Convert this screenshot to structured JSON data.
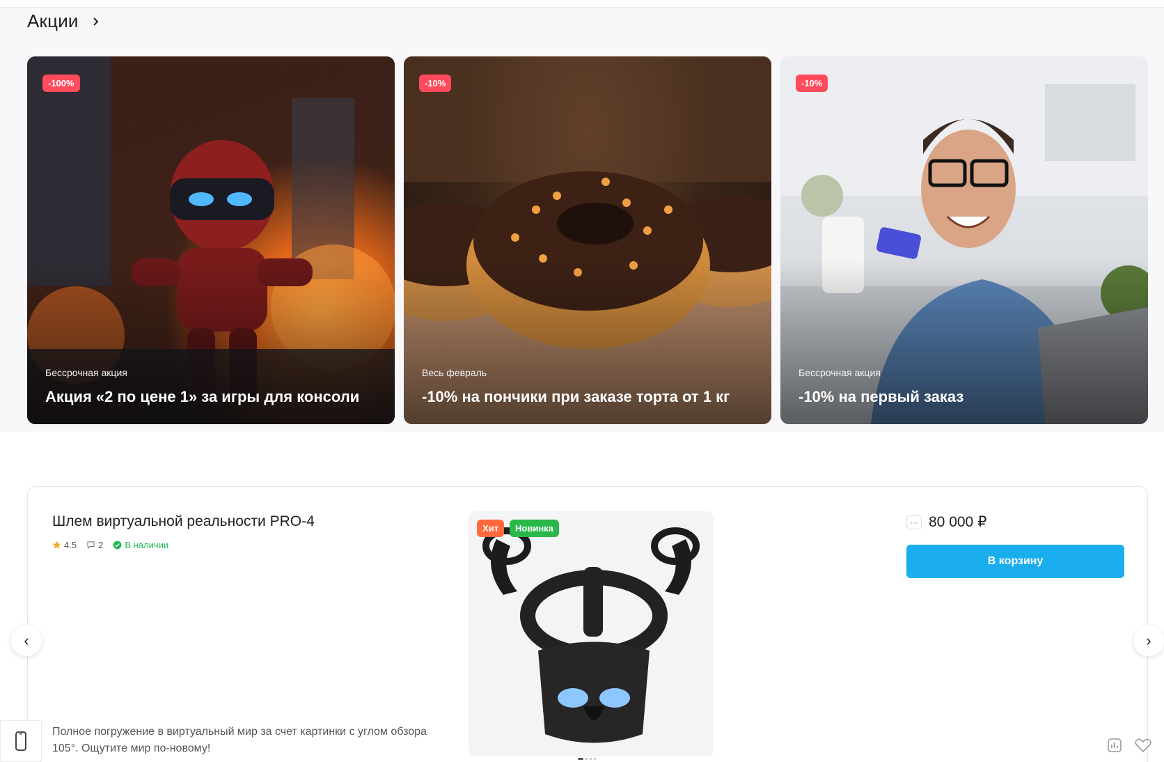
{
  "promo": {
    "title": "Акции",
    "cards": [
      {
        "badge": "-100%",
        "subtitle": "Бессрочная акция",
        "title": "Акция «2 по цене 1» за игры для консоли"
      },
      {
        "badge": "-10%",
        "subtitle": "Весь февраль",
        "title": "-10% на пончики при заказе торта от 1 кг"
      },
      {
        "badge": "-10%",
        "subtitle": "Бессрочная акция",
        "title": "-10% на первый заказ"
      }
    ]
  },
  "product": {
    "name": "Шлем виртуальной реальности PRO-4",
    "rating": "4.5",
    "reviews": "2",
    "availability": "В наличии",
    "tags": {
      "hit": "Хит",
      "new": "Новинка"
    },
    "price": "80 000 ₽",
    "cart_label": "В корзину",
    "description": "Полное погружение в виртуальный мир за счет картинки с углом обзора 105°. Ощутите мир по-новому!"
  },
  "colors": {
    "badge": "#ff4b5c",
    "cta": "#1aaeef",
    "stock": "#1db954",
    "hit": "#ff6a3d",
    "new": "#2bb84b"
  },
  "icons": [
    "chevron-right-icon",
    "star-icon",
    "comment-icon",
    "check-icon",
    "more-icon",
    "compare-icon",
    "heart-icon",
    "phone-icon",
    "arrow-left-icon",
    "arrow-right-icon"
  ]
}
